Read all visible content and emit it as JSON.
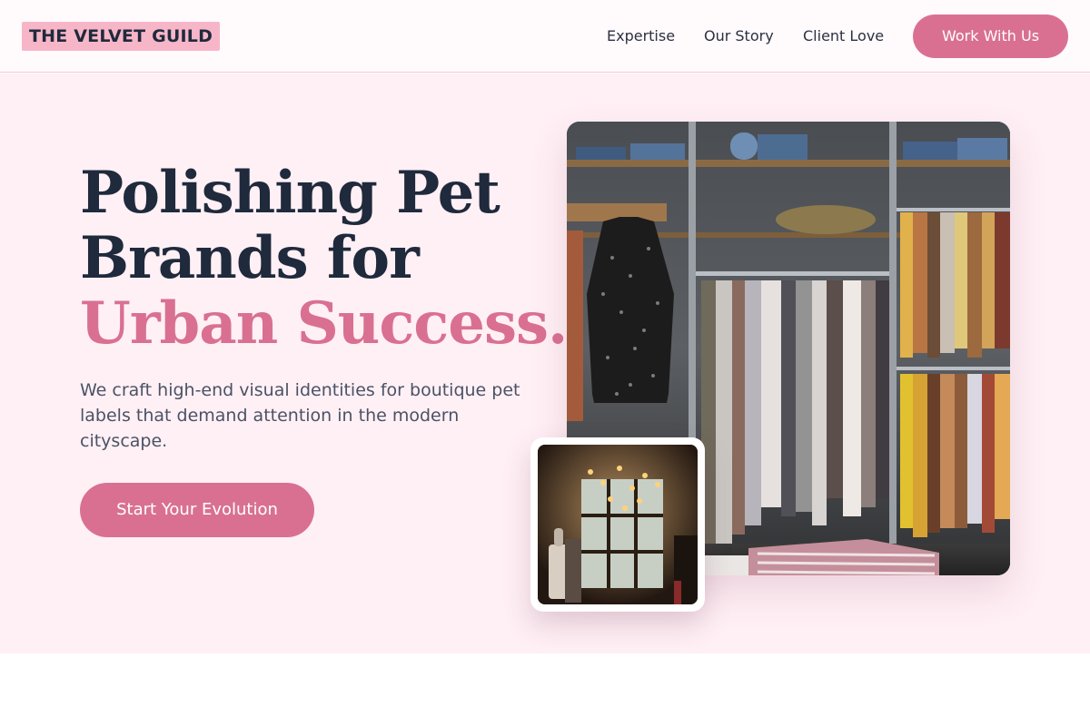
{
  "header": {
    "logo": "THE VELVET GUILD",
    "nav": [
      "Expertise",
      "Our Story",
      "Client Love"
    ],
    "cta": "Work With Us"
  },
  "hero": {
    "headline_line1": "Polishing Pet",
    "headline_line2": "Brands for",
    "headline_accent": "Urban Success.",
    "subtext": "We craft high-end visual identities for boutique pet labels that demand attention in the modern cityscape.",
    "cta": "Start Your Evolution"
  },
  "images": {
    "main": "clothing-rack-photo",
    "inset": "boutique-interior-photo"
  },
  "colors": {
    "accent": "#d97092",
    "logo_bg": "#f7b6c8",
    "hero_bg": "#fff0f5",
    "text_dark": "#1f2a3c"
  }
}
